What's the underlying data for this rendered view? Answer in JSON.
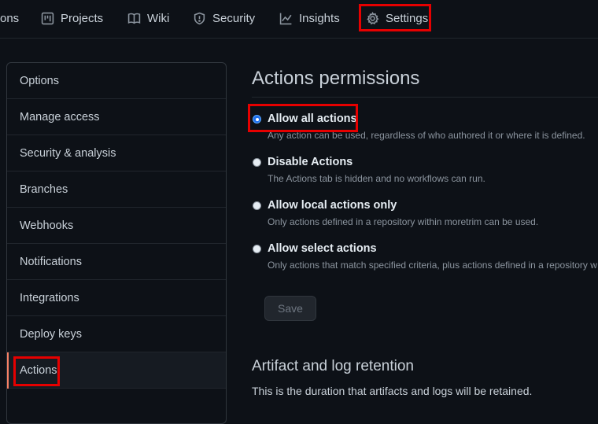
{
  "nav": {
    "items": [
      {
        "label": "ons",
        "icon": "none"
      },
      {
        "label": "Projects",
        "icon": "project-board-icon"
      },
      {
        "label": "Wiki",
        "icon": "book-icon"
      },
      {
        "label": "Security",
        "icon": "shield-icon"
      },
      {
        "label": "Insights",
        "icon": "graph-icon"
      },
      {
        "label": "Settings",
        "icon": "gear-icon"
      }
    ]
  },
  "sidebar": {
    "items": [
      {
        "label": "Options"
      },
      {
        "label": "Manage access"
      },
      {
        "label": "Security & analysis"
      },
      {
        "label": "Branches"
      },
      {
        "label": "Webhooks"
      },
      {
        "label": "Notifications"
      },
      {
        "label": "Integrations"
      },
      {
        "label": "Deploy keys"
      },
      {
        "label": "Actions"
      }
    ]
  },
  "main": {
    "title": "Actions permissions",
    "options": [
      {
        "label": "Allow all actions",
        "desc": "Any action can be used, regardless of who authored it or where it is defined.",
        "checked": true
      },
      {
        "label": "Disable Actions",
        "desc": "The Actions tab is hidden and no workflows can run.",
        "checked": false
      },
      {
        "label": "Allow local actions only",
        "desc": "Only actions defined in a repository within moretrim can be used.",
        "checked": false
      },
      {
        "label": "Allow select actions",
        "desc": "Only actions that match specified criteria, plus actions defined in a repository w",
        "checked": false
      }
    ],
    "save_label": "Save",
    "artifact_title": "Artifact and log retention",
    "artifact_desc": "This is the duration that artifacts and logs will be retained."
  },
  "colors": {
    "background": "#0d1117",
    "highlight": "#e60000",
    "active_bar": "#f78166",
    "radio_checked": "#1f6feb"
  }
}
